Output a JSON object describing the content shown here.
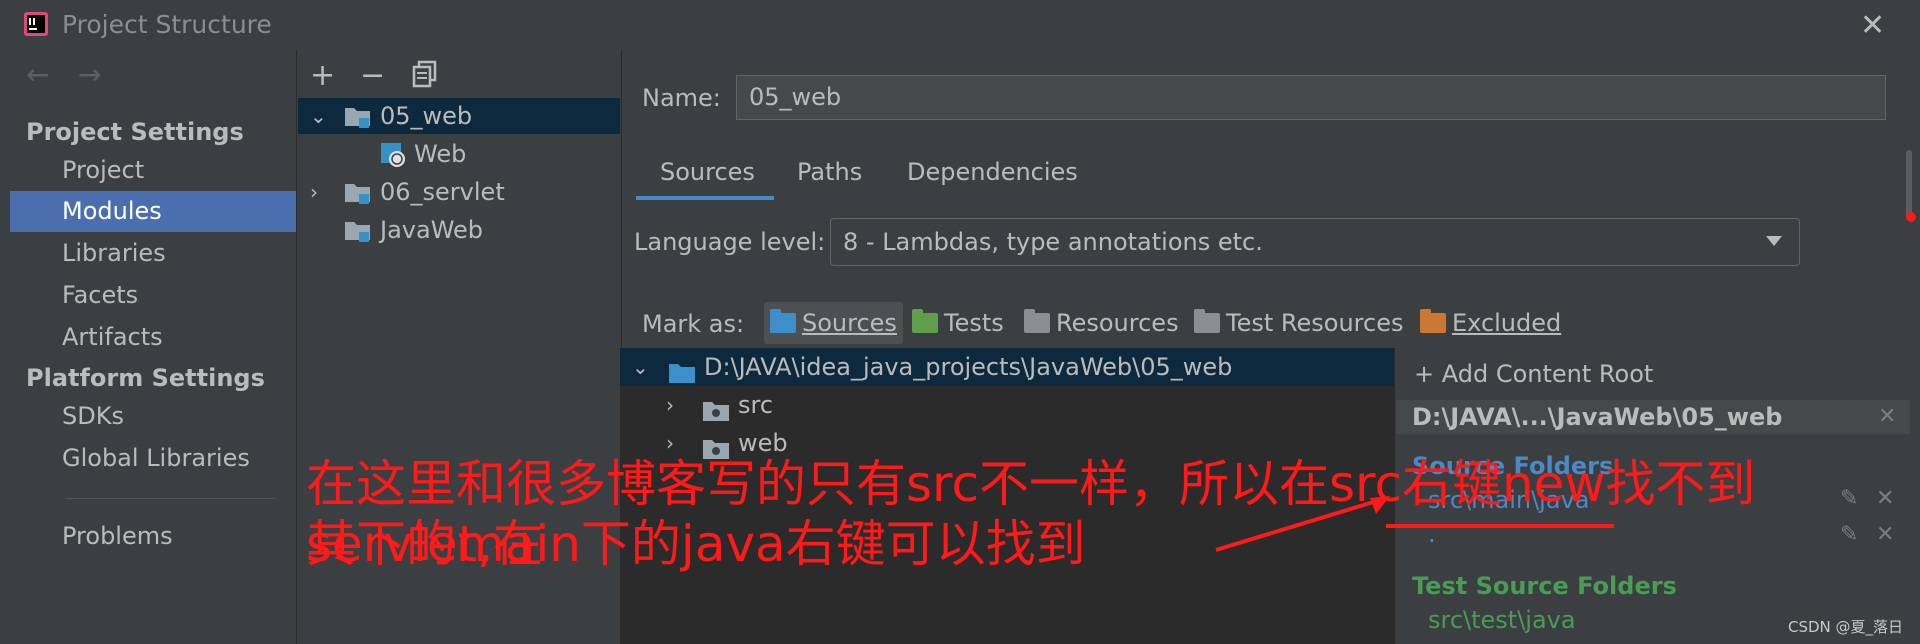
{
  "window": {
    "title": "Project Structure"
  },
  "nav": {
    "back_icon": "arrow-left-icon",
    "forward_icon": "arrow-right-icon",
    "project_settings": "Project Settings",
    "project": "Project",
    "modules": "Modules",
    "libraries": "Libraries",
    "facets": "Facets",
    "artifacts": "Artifacts",
    "platform_settings": "Platform Settings",
    "sdks": "SDKs",
    "global_libraries": "Global Libraries",
    "problems": "Problems"
  },
  "tree": {
    "add": "+",
    "remove": "−",
    "items": [
      {
        "label": "05_web"
      },
      {
        "label": "Web"
      },
      {
        "label": "06_servlet"
      },
      {
        "label": "JavaWeb"
      }
    ]
  },
  "module": {
    "name_label": "Name:",
    "name_value": "05_web",
    "tabs": [
      "Sources",
      "Paths",
      "Dependencies"
    ],
    "language_label": "Language level:",
    "language_value": "8 - Lambdas, type annotations etc.",
    "mark_as_label": "Mark as:",
    "mark_sources": "Sources",
    "mark_tests": "Tests",
    "mark_resources": "Resources",
    "mark_test_resources": "Test Resources",
    "mark_excluded": "Excluded"
  },
  "content": {
    "root": "D:\\JAVA\\idea_java_projects\\JavaWeb\\05_web",
    "children": [
      "src",
      "web"
    ]
  },
  "panel": {
    "add_root": "Add Content Root",
    "root_head": "D:\\JAVA\\...\\JavaWeb\\05_web",
    "source_title": "Source Folders",
    "source_path": "src\\main\\java",
    "source_path2": ".",
    "test_title": "Test Source Folders",
    "test_path": "src\\test\\java"
  },
  "annotation": {
    "line1": "在这里和很多博客写的只有src不一样，所以在src右键new找不到servlet,在",
    "line2": "其下的main下的java右键可以找到"
  },
  "watermark": "CSDN @夏_落日",
  "colors": {
    "source_blue": "#4a88c7",
    "test_green": "#499c54",
    "resources_orange": "#c9a03c",
    "excluded_orange": "#cc7832",
    "annotation_red": "#ff1a1a",
    "selection": "#4b6eaf"
  }
}
